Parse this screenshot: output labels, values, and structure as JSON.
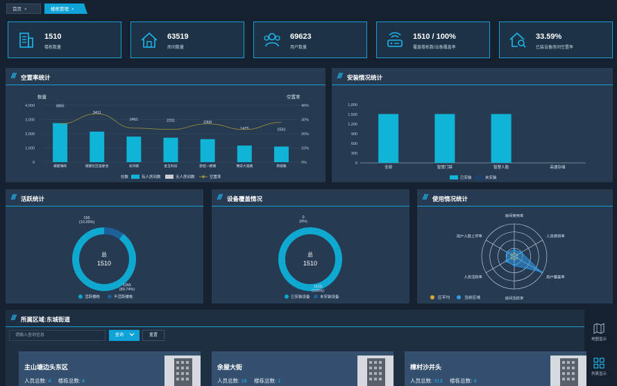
{
  "tabs": [
    {
      "label": "首页",
      "close": "×"
    },
    {
      "label": "楼栋管理",
      "close": "×"
    }
  ],
  "stats": [
    {
      "value": "1510",
      "label": "楼栋数量",
      "icon": "building-icon"
    },
    {
      "value": "63519",
      "label": "房间数量",
      "icon": "house-icon"
    },
    {
      "value": "69623",
      "label": "用户数量",
      "icon": "users-icon"
    },
    {
      "value": "1510 / 100%",
      "label": "覆盖楼栋数/设备覆盖率",
      "icon": "router-icon"
    },
    {
      "value": "33.59%",
      "label": "已装设备房间空置率",
      "icon": "home-search-icon"
    }
  ],
  "panels": {
    "vacancy": "空置率统计",
    "install": "安装情况统计",
    "active": "活跃统计",
    "coverage": "设备覆盖情况",
    "usage": "使用情况统计",
    "region": "所属区域:东城街道"
  },
  "region": {
    "search_placeholder": "请输入查询信息",
    "query_label": "查询",
    "reset_label": "重置",
    "people_label": "人员总数:",
    "building_label": "楼栋总数:",
    "cards": [
      {
        "name": "主山塘边头东区",
        "people": "4",
        "buildings": "4"
      },
      {
        "name": "余屋大街",
        "people": "18",
        "buildings": "1"
      },
      {
        "name": "樟村沙井头",
        "people": "313",
        "buildings": "4"
      }
    ]
  },
  "side_tools": [
    {
      "label": "地图显示",
      "icon": "map-icon"
    },
    {
      "label": "列表显示",
      "icon": "grid-icon"
    }
  ],
  "colors": {
    "accent": "#1eb6ee",
    "bar": "#0fb4d6",
    "line": "#9a8a3a",
    "ring": "#0fa8d0",
    "ring_dark": "#1d5f99"
  },
  "chart_data": [
    {
      "type": "bar",
      "title": "空置率统计",
      "categories": [
        "塘厦镇政",
        "塘厦社区居委会",
        "龙华路",
        "金玉科技",
        "碧桂一路镇",
        "瑞安大道路",
        "南城路"
      ],
      "series": [
        {
          "name": "有人房间数",
          "values": [
            2750,
            2150,
            1800,
            1720,
            1620,
            1170,
            1100
          ]
        },
        {
          "name": "无人房间数",
          "values": [
            0,
            0,
            0,
            0,
            0,
            0,
            0
          ]
        },
        {
          "name": "空置率",
          "values": [
            27,
            34,
            24,
            23,
            27,
            23,
            28
          ],
          "axis": "right"
        }
      ],
      "data_labels": [
        "3865",
        "3411",
        "2451",
        "2201",
        "2306",
        "1475",
        "1531"
      ],
      "legend_prefix": "仿数",
      "ylabel": "数量",
      "ylabel_right": "空置率",
      "ylim": [
        0,
        4000
      ],
      "ylim_right": [
        0,
        40
      ],
      "yticks": [
        "0",
        "1,000",
        "2,000",
        "3,000",
        "4,000"
      ],
      "yticks_right": [
        "0%",
        "10%",
        "20%",
        "30%",
        "40%"
      ],
      "legend": "bottom"
    },
    {
      "type": "bar",
      "title": "安装情况统计",
      "categories": [
        "全部",
        "智慧门禁",
        "智慧人脸",
        "高速存储"
      ],
      "series": [
        {
          "name": "已安装",
          "values": [
            1510,
            1510,
            1510,
            0
          ]
        },
        {
          "name": "未安装",
          "values": [
            0,
            0,
            0,
            0
          ]
        }
      ],
      "ylim": [
        0,
        1800
      ],
      "yticks": [
        "0",
        "300",
        "600",
        "900",
        "1,200",
        "1,500",
        "1,800"
      ],
      "legend": "bottom"
    },
    {
      "type": "pie",
      "title": "活跃统计",
      "center_label": "总",
      "center_value": "1510",
      "slices": [
        {
          "name": "活跃楼栋",
          "value": 1355,
          "label": "1355",
          "pct": "(89.74%)"
        },
        {
          "name": "不活跃楼栋",
          "value": 155,
          "label": "155",
          "pct": "(10.26%)"
        }
      ],
      "legend": "bottom"
    },
    {
      "type": "pie",
      "title": "设备覆盖情况",
      "center_label": "总",
      "center_value": "1510",
      "slices": [
        {
          "name": "已安装设备",
          "value": 1510,
          "label": "1510",
          "pct": "(100%)"
        },
        {
          "name": "未安装设备",
          "value": 0,
          "label": "0",
          "pct": "(0%)"
        }
      ],
      "legend": "bottom"
    },
    {
      "type": "radar",
      "title": "使用情况统计",
      "indicators": [
        "房间使用率",
        "人员使用率",
        "用户覆盖率",
        "房间活跃率",
        "人员活跃率",
        "用户人脸上传率"
      ],
      "series": [
        {
          "name": "区平均",
          "values": [
            0.1,
            0.1,
            0.1,
            0.1,
            0.1,
            0.1
          ],
          "color": "#e0a53a"
        },
        {
          "name": "当前区域",
          "values": [
            0.2,
            0.25,
            0.95,
            0.28,
            0.3,
            0.25
          ],
          "color": "#2e9bea"
        }
      ],
      "legend": "bottom"
    }
  ]
}
